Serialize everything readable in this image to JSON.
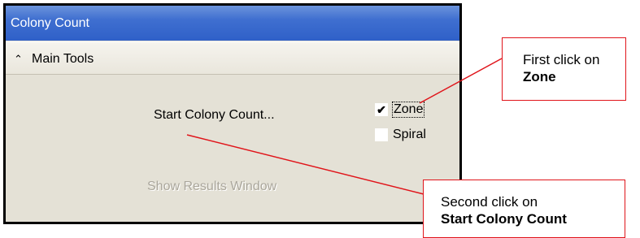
{
  "window": {
    "title": "Colony Count"
  },
  "section": {
    "label": "Main Tools"
  },
  "actions": {
    "start_label": "Start Colony Count...",
    "show_results_label": "Show Results Window"
  },
  "options": {
    "zone": {
      "label": "Zone",
      "checked": true
    },
    "spiral": {
      "label": "Spiral",
      "checked": false
    }
  },
  "callouts": {
    "first": {
      "text": "First click on",
      "bold": "Zone"
    },
    "second": {
      "text": "Second click on",
      "bold": "Start Colony Count"
    }
  },
  "colors": {
    "annotation": "#e0141a",
    "titlebar": "#2f60c8",
    "panel": "#e4e1d6"
  },
  "icons": {
    "collapse": "double-chevron-up-icon",
    "check": "checkmark-icon"
  }
}
